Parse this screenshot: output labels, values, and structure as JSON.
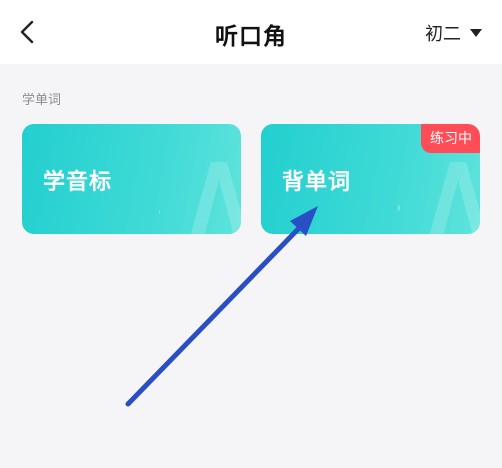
{
  "header": {
    "title": "听口角",
    "grade": "初二"
  },
  "section": {
    "title": "学单词"
  },
  "cards": [
    {
      "label": "学音标"
    },
    {
      "label": "背单词",
      "badge": "练习中"
    }
  ],
  "colors": {
    "card_gradient_start": "#22cfcf",
    "card_gradient_end": "#5fe3dc",
    "badge": "#ff4d57",
    "arrow": "#2a4fc4",
    "background": "#f5f5f7"
  },
  "icons": {
    "back": "chevron-left-icon",
    "dropdown": "caret-down-icon",
    "card_decoration": "letter-a-decoration-icon"
  }
}
